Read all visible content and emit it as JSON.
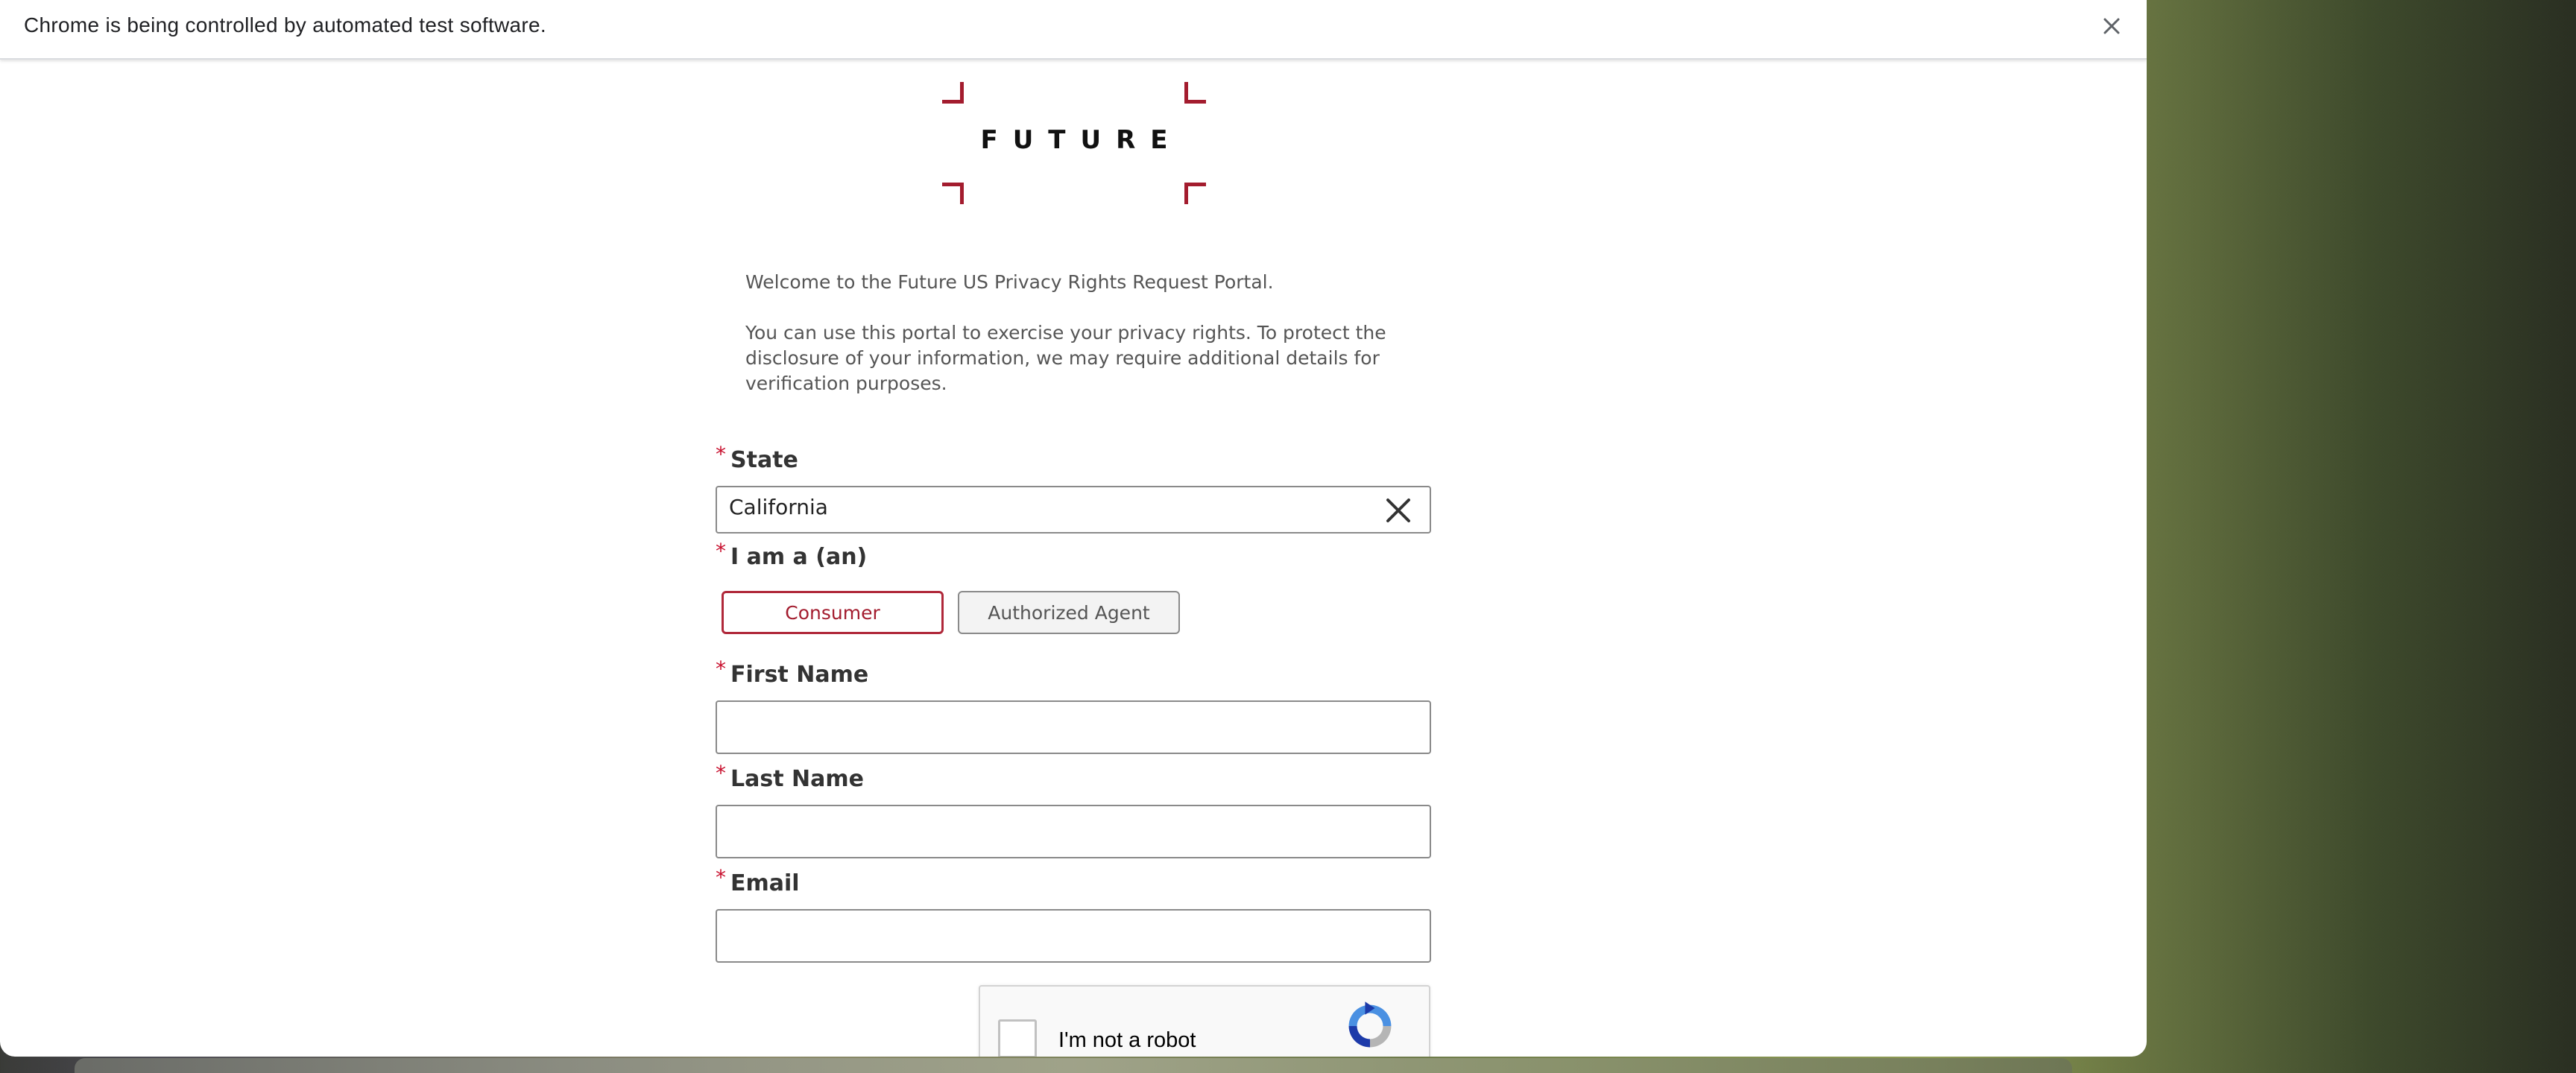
{
  "infobar": {
    "message": "Chrome is being controlled by automated test software.",
    "close_icon": "close-icon"
  },
  "logo": {
    "text": "FUTURE",
    "accent_color": "#a31c2e"
  },
  "intro": {
    "welcome": "Welcome to the Future US Privacy Rights Request Portal.",
    "description": "You can use this portal to exercise your privacy rights. To protect the disclosure of your information, we may require additional details for verification purposes."
  },
  "form": {
    "required_marker": "*",
    "state": {
      "label": "State",
      "value": "California",
      "clear_icon": "close-icon"
    },
    "requester_type": {
      "label": "I am a (an)",
      "options": [
        "Consumer",
        "Authorized Agent"
      ],
      "selected": "Consumer"
    },
    "first_name": {
      "label": "First Name",
      "value": ""
    },
    "last_name": {
      "label": "Last Name",
      "value": ""
    },
    "email": {
      "label": "Email",
      "value": ""
    }
  },
  "recaptcha": {
    "label": "I'm not a robot",
    "checked": false,
    "icon": "recaptcha-logo-icon"
  }
}
